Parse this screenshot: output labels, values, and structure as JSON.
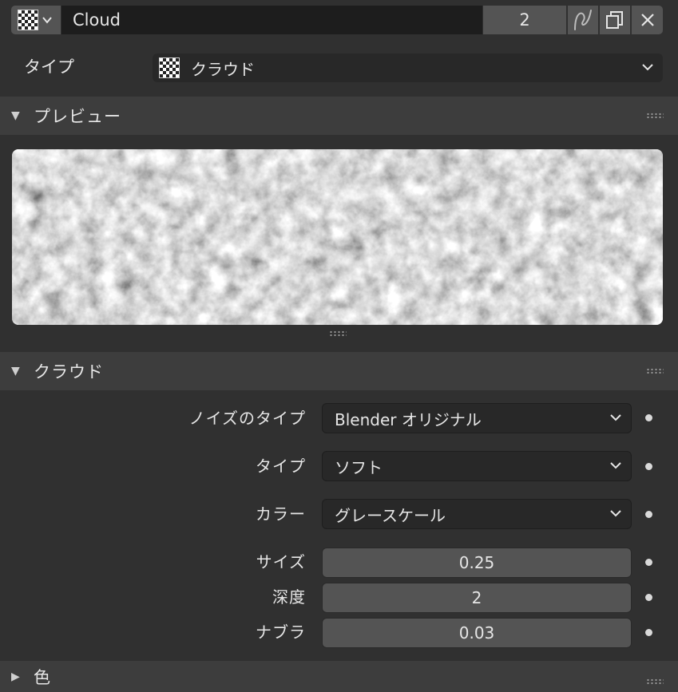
{
  "texture": {
    "name": "Cloud",
    "users": "2"
  },
  "type_row": {
    "label": "タイプ",
    "value": "クラウド"
  },
  "preview_panel": {
    "title": "プレビュー"
  },
  "cloud_panel": {
    "title": "クラウド",
    "noise_type": {
      "label": "ノイズのタイプ",
      "value": "Blender オリジナル"
    },
    "cloud_type": {
      "label": "タイプ",
      "value": "ソフト"
    },
    "color": {
      "label": "カラー",
      "value": "グレースケール"
    },
    "size": {
      "label": "サイズ",
      "value": "0.25"
    },
    "depth": {
      "label": "深度",
      "value": "2"
    },
    "nabla": {
      "label": "ナブラ",
      "value": "0.03"
    }
  },
  "color_panel": {
    "title": "色"
  },
  "icons": [
    "checker-texture-icon",
    "chevron-down-icon",
    "fake-user-icon",
    "duplicate-icon",
    "close-icon",
    "panel-collapse-arrow-icon",
    "panel-expand-arrow-icon",
    "drag-grip-icon",
    "animate-dot-icon"
  ],
  "colors": {
    "background": "#303030",
    "panel_header": "#3d3d3d",
    "field_dark": "#282828",
    "field_number": "#545454",
    "text": "#e6e6e6"
  }
}
